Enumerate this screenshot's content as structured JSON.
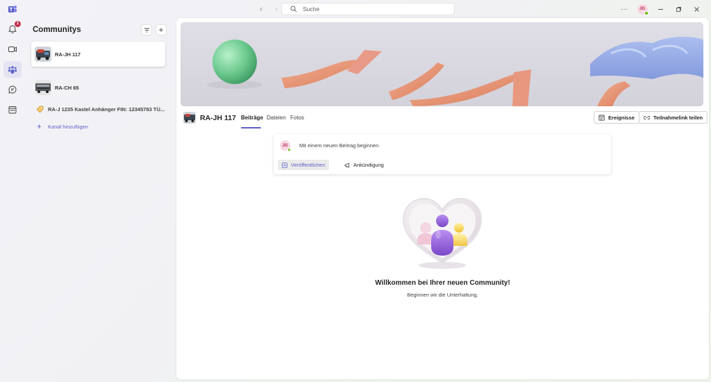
{
  "titlebar": {
    "search_placeholder": "Suche",
    "more_label": "···",
    "user_initials": "JG"
  },
  "rail": {
    "activity_badge": "1",
    "items": [
      "teams-logo-icon",
      "bell-icon",
      "video-icon",
      "communities-icon",
      "chat-icon",
      "calendar-icon"
    ]
  },
  "panel": {
    "title": "Communitys",
    "filter_icon": "filter-icon",
    "add_label": "+",
    "communities": [
      {
        "name": "RA-JH 117",
        "selected": true
      },
      {
        "name": "RA-CH 65",
        "selected": false
      }
    ],
    "channel": {
      "name": "RA-J 1235 Kastel Anhänger FIN: 12345783 TÜ..."
    },
    "add_channel": {
      "icon": "+",
      "label": "Kanal hinzufügen"
    }
  },
  "main": {
    "community_name": "RA-JH 117",
    "tabs": [
      "Beiträge",
      "Dateien",
      "Fotos"
    ],
    "active_tab": "Beiträge",
    "events_button": "Ereignisse",
    "share_button": "Teilnahmelink teilen",
    "composer": {
      "avatar_initials": "JG",
      "prompt": "Mit einem neuen Beitrag beginnen",
      "publish": "Veröffentlichen",
      "announcement": "Ankündigung"
    },
    "welcome": {
      "title": "Willkommen bei Ihrer neuen Community!",
      "subtitle": "Beginnen wir die Unterhaltung."
    }
  },
  "colors": {
    "accent": "#5b5fc7",
    "badge": "#c4314b",
    "presence": "#6bb700"
  }
}
